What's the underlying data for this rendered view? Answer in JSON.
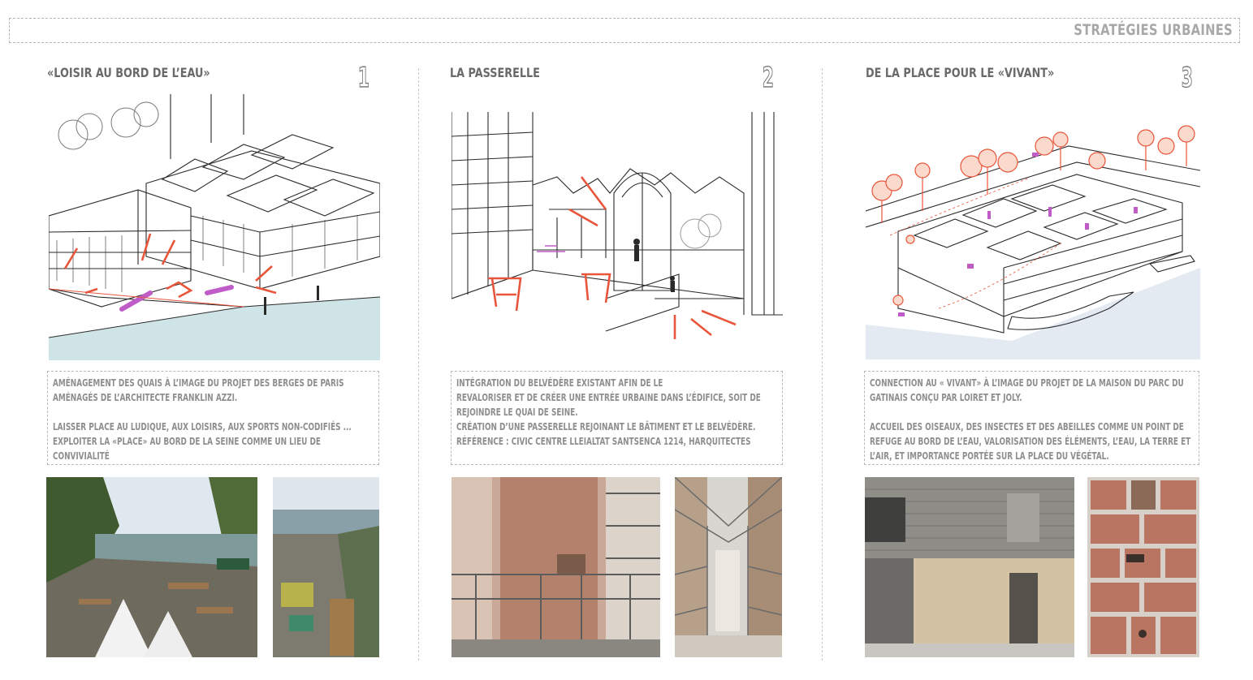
{
  "header": {
    "title": "STRATÉGIES URBAINES"
  },
  "sections": [
    {
      "title": "«LOISIR AU BORD DE L’EAU»",
      "number": "1",
      "text": "AMÉNAGEMENT DES QUAIS À L’IMAGE DU PROJET DES BERGES DE PARIS AMÉNAGÉS DE L’ARCHITECTE FRANKLIN AZZI.\n\nLAISSER PLACE AU LUDIQUE, AUX LOISIRS, AUX SPORTS NON-CODIFIÉS ...\nEXPLOITER LA «PLACE» AU BORD DE LA SEINE COMME UN LIEU DE CONVIVIALITÉ"
    },
    {
      "title": "LA PASSERELLE",
      "number": "2",
      "text": "INTÉGRATION DU BELVÉDÈRE EXISTANT AFIN DE LE\nREVALORISER ET DE CRÉER UNE ENTRÉE URBAINE DANS L’ÉDIFICE, SOIT DE REJOINDRE LE QUAI DE SEINE.\nCRÉATION D’UNE PASSERELLE REJOINANT LE BÂTIMENT ET LE BELVÉDÈRE.\nRÉFÉRENCE : CIVIC CENTRE LLEIALTAT SANTSENCA 1214, HARQUITECTES"
    },
    {
      "title": "DE LA PLACE POUR LE «VIVANT»",
      "number": "3",
      "text": "CONNECTION  AU « VIVANT» À L’IMAGE DU PROJET DE LA MAISON DU PARC DU GATINAIS CONÇU PAR LOIRET ET JOLY.\n\nACCUEIL DES OISEAUX, DES INSECTES ET DES ABEILLES COMME UN POINT DE REFUGE AU BORD DE L’EAU, VALORISATION DES ÉLÉMENTS, L’EAU, LA TERRE ET L’AIR, ET IMPORTANCE PORTÉE SUR LA PLACE DU VÉGÉTAL."
    }
  ],
  "colors": {
    "accent": "#e8553a",
    "magenta": "#c05cc8",
    "water": "#cfe4e6",
    "ink": "#2a2a2a"
  }
}
